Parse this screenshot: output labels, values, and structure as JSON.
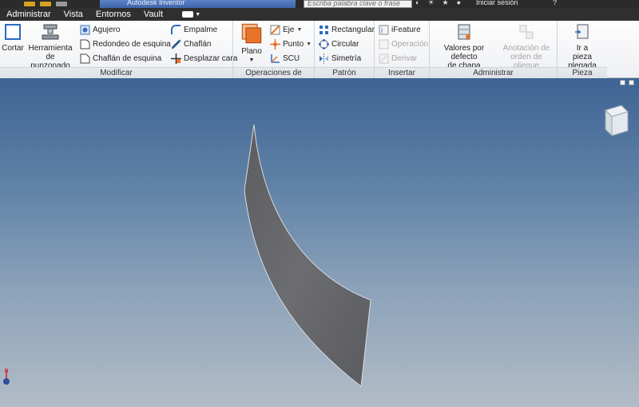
{
  "titlebar": {
    "app_title": "Autodesk Inventor",
    "search_placeholder": "Escriba palabra clave o frase",
    "signin_label": "Iniciar sesión",
    "help_label": "?"
  },
  "menu": {
    "items": [
      "Administrar",
      "Vista",
      "Entornos",
      "Vault"
    ]
  },
  "ribbon": {
    "panels": {
      "modificar": "Modificar",
      "operaciones": "Operaciones de trabajo",
      "patron": "Patrón",
      "insertar": "Insertar",
      "administrar": "Administrar",
      "pieza_plegada": "Pieza plegada"
    },
    "buttons": {
      "cortar": "Cortar",
      "herramienta_line1": "Herramienta de",
      "herramienta_line2": "punzonado",
      "agujero": "Agujero",
      "redondeo": "Redondeo de esquina",
      "chaflan_esquina": "Chaflán de esquina",
      "empalme": "Empalme",
      "chaflan": "Chaflán",
      "desplazar_cara": "Desplazar cara",
      "plano": "Plano",
      "eje": "Eje",
      "punto": "Punto",
      "scu": "SCU",
      "rectangular": "Rectangular",
      "circular": "Circular",
      "simetria": "Simetría",
      "ifeature": "iFeature",
      "operacion": "Operación",
      "derivar": "Derivar",
      "valores_line1": "Valores por defecto",
      "valores_line2": "de chapa",
      "anotacion_line1": "Anotación de",
      "anotacion_line2": "orden de pliegue",
      "ir_line1": "Ir a",
      "ir_line2": "pieza plegada"
    }
  },
  "colors": {
    "accent_orange": "#e8742b",
    "viewport_top": "#3e6494",
    "viewport_bottom": "#b2bcc6",
    "sheet_face": "#6a6b6f",
    "disabled_text": "#a6a6a6"
  }
}
